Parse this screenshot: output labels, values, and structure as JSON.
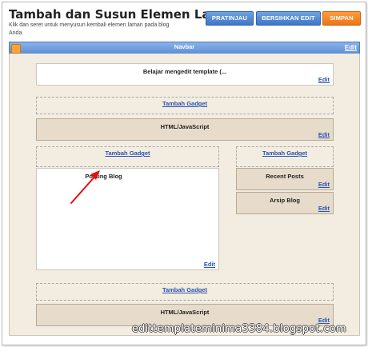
{
  "header": {
    "title": "Tambah dan Susun Elemen Laman",
    "subtitle": "Klik dan seret untuk menyusun kembali elemen laman pada blog Anda."
  },
  "toolbar": {
    "preview_label": "PRATINJAU",
    "clear_label": "BERSIHKAN EDIT",
    "save_label": "SIMPAN"
  },
  "navbar": {
    "label": "Navbar",
    "edit": "Edit"
  },
  "header_gadget": {
    "title": "Belajar mengedit template (...",
    "edit": "Edit"
  },
  "top_section": {
    "add_gadget": "Tambah Gadget",
    "gadget_title": "HTML/JavaScript",
    "edit": "Edit"
  },
  "main_column": {
    "add_gadget": "Tambah Gadget",
    "posts_title": "Posting Blog",
    "edit": "Edit"
  },
  "sidebar": {
    "add_gadget": "Tambah Gadget",
    "items": [
      {
        "title": "Recent Posts",
        "edit": "Edit"
      },
      {
        "title": "Arsip Blog",
        "edit": "Edit"
      }
    ]
  },
  "footer_section": {
    "add_gadget": "Tambah Gadget",
    "gadget_title": "HTML/JavaScript",
    "edit": "Edit"
  },
  "watermark": "edittemplateminima3384.blogspot.com",
  "colors": {
    "accent_blue": "#4a7cc4",
    "save_orange": "#f07414",
    "arrow_red": "#e01010",
    "canvas_bg": "#f3ece1"
  }
}
